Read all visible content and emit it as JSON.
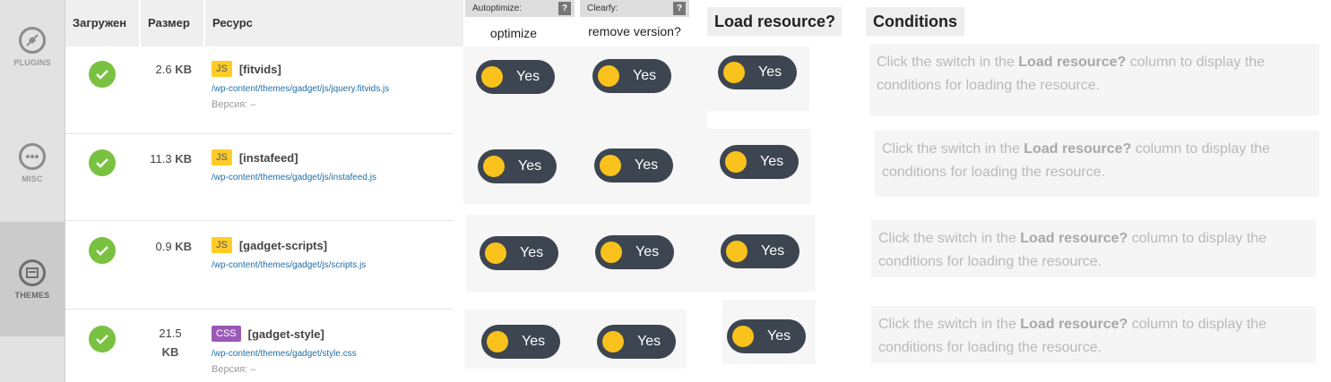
{
  "sidebar": {
    "items": [
      {
        "label": "PLUGINS",
        "icon": "plug-icon"
      },
      {
        "label": "MISC",
        "icon": "more-dots-icon"
      },
      {
        "label": "THEMES",
        "icon": "themes-icon",
        "active": true
      }
    ]
  },
  "table": {
    "headers": {
      "loaded": "Загружен",
      "size": "Размер",
      "resource": "Ресурс"
    },
    "rows": [
      {
        "size_num": "2.6",
        "size_unit": "KB",
        "type": "JS",
        "name": "[fitvids]",
        "path": "/wp-content/themes/gadget/js/jquery.fitvids.js",
        "version": "Версия: –"
      },
      {
        "size_num": "11.3",
        "size_unit": "KB",
        "type": "JS",
        "name": "[instafeed]",
        "path": "/wp-content/themes/gadget/js/instafeed.js",
        "version": ""
      },
      {
        "size_num": "0.9",
        "size_unit": "KB",
        "type": "JS",
        "name": "[gadget-scripts]",
        "path": "/wp-content/themes/gadget/js/scripts.js",
        "version": ""
      },
      {
        "size_num": "21.5",
        "size_unit": "KB",
        "type": "CSS",
        "name": "[gadget-style]",
        "path": "/wp-content/themes/gadget/style.css",
        "version": "Версия: –"
      }
    ]
  },
  "autoptimize": {
    "header": "Autoptimize:",
    "help": "?",
    "sub": "optimize"
  },
  "clearfy": {
    "header": "Clearfy:",
    "help": "?",
    "sub": "remove version?"
  },
  "toggle_label": "Yes",
  "load_resource_header": "Load resource?",
  "conditions_header": "Conditions",
  "conditions_text": {
    "pre": "Click the switch in the ",
    "bold": "Load resource?",
    "post": " column to display the conditions for loading the resource."
  },
  "colors": {
    "check": "#7ac142",
    "toggle_bg": "#3c4550",
    "knob": "#f9c21c",
    "js_badge": "#ffcc29",
    "css_badge": "#9b59b6",
    "path_link": "#1f6fa6"
  }
}
